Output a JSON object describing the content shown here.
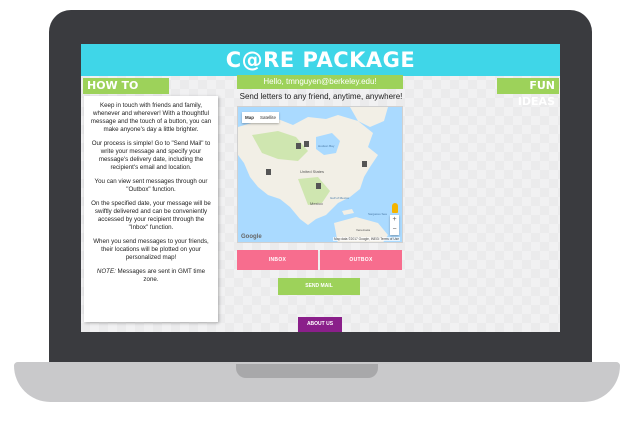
{
  "app": {
    "title": "C@RE PACKAGE",
    "greeting": "Hello, tmnguyen@berkeley.edu!",
    "tagline": "Send letters to any friend, anytime, anywhere!"
  },
  "sidebar_left": {
    "heading": "HOW TO USE",
    "paragraphs": [
      "Keep in touch with friends and family, whenever and wherever! With a thoughtful message and the touch of a button, you can make anyone's day a little brighter.",
      "Our process is simple! Go to \"Send Mail\" to write your message and specify your message's delivery date, including the recipient's email and location.",
      "You can view sent messages through our \"Outbox\" function.",
      "On the specified date, your message will be swiftly delivered and can be conveniently accessed by your recipient through the \"Inbox\" function.",
      "When you send messages to your friends, their locations will be plotted on your personalized map!"
    ],
    "note_label": "NOTE:",
    "note_text": " Messages are sent in GMT time zone."
  },
  "sidebar_right": {
    "heading": "FUN IDEAS"
  },
  "map": {
    "toggle_map": "Map",
    "toggle_satellite": "Satellite",
    "zoom_in": "+",
    "zoom_out": "−",
    "logo": "Google",
    "attribution": "Map data ©2017 Google, INEGI   Terms of Use",
    "labels": {
      "united_states": "United States",
      "mexico": "Mexico",
      "gulf": "Gulf of Mexico",
      "hudson": "Hudson Bay",
      "sargasso": "Sargasso Sea",
      "venezuela": "Venezuela"
    },
    "colors": {
      "water": "#aadaff",
      "land": "#f2efe6",
      "green": "#cfe6b0"
    }
  },
  "buttons": {
    "inbox": "INBOX",
    "outbox": "OUTBOX",
    "send_mail": "SEND MAIL",
    "about_us": "ABOUT US"
  },
  "colors": {
    "header": "#3fd6e8",
    "green": "#9dd25a",
    "pink": "#f76d8e",
    "purple": "#8a1f8a",
    "laptop": "#3a3b3f"
  }
}
